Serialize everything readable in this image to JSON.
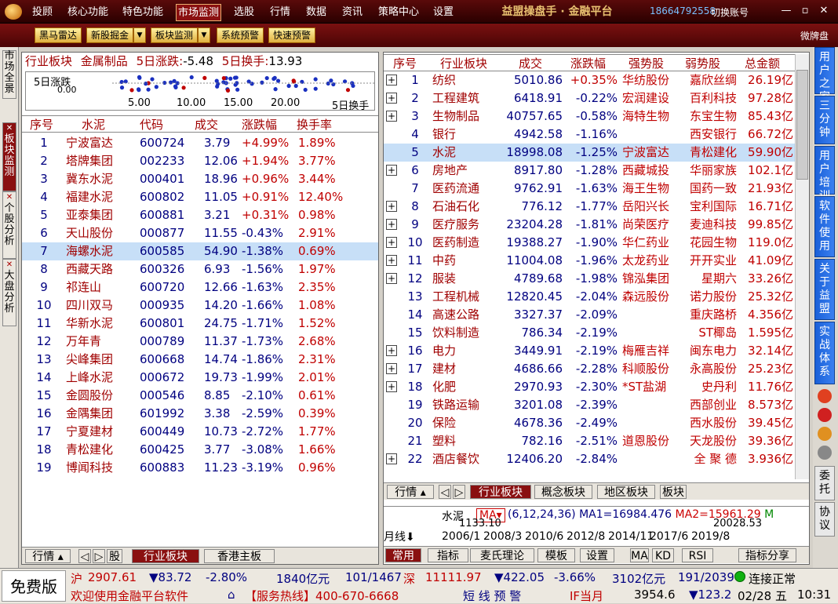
{
  "menu": [
    "投顾",
    "核心功能",
    "特色功能",
    "市场监测",
    "选股",
    "行情",
    "数据",
    "资讯",
    "策略中心",
    "设置"
  ],
  "active_menu": "市场监测",
  "brand": "益盟操盘手 · 金融平台",
  "phone": "18664792558",
  "switch_account": "切换账号",
  "toolbar": {
    "buttons": [
      "黑马雷达",
      "新股掘金",
      "板块监测",
      "系统预警",
      "快速预警"
    ],
    "right": "微牌盘"
  },
  "left_tabs": [
    {
      "label": "市场全景",
      "active": false
    },
    {
      "label": "板块监测",
      "active": true
    },
    {
      "label": "个股分析",
      "active": false
    },
    {
      "label": "大盘分析",
      "active": false
    }
  ],
  "right_tabs": [
    "用户之家",
    "三分钟",
    "用户培训",
    "软件使用",
    "关于益盟",
    "实战体系"
  ],
  "right_tabs_bottom": [
    "委托",
    "协议"
  ],
  "left_panel": {
    "header": {
      "label": "行业板块",
      "sector": "金属制品",
      "chg_label": "5日涨跌:",
      "chg": "-5.48",
      "turn_label": "5日换手:",
      "turn": "13.93"
    },
    "mini_chart": {
      "ylabel": "5日涨跌",
      "ylabel2": "0.00",
      "xticks": [
        "5.00",
        "10.00",
        "15.00",
        "20.00"
      ],
      "xlabel": "5日换手"
    },
    "columns": [
      "序号",
      "水泥",
      "代码",
      "成交",
      "涨跌幅",
      "换手率"
    ],
    "rows": [
      [
        "1",
        "宁波富达",
        "600724",
        "3.79",
        "+4.99%",
        "1.89%"
      ],
      [
        "2",
        "塔牌集团",
        "002233",
        "12.06",
        "+1.94%",
        "3.77%"
      ],
      [
        "3",
        "冀东水泥",
        "000401",
        "18.96",
        "+0.96%",
        "3.44%"
      ],
      [
        "4",
        "福建水泥",
        "600802",
        "11.05",
        "+0.91%",
        "12.40%"
      ],
      [
        "5",
        "亚泰集团",
        "600881",
        "3.21",
        "+0.31%",
        "0.98%"
      ],
      [
        "6",
        "天山股份",
        "000877",
        "11.55",
        "-0.43%",
        "2.91%"
      ],
      [
        "7",
        "海螺水泥",
        "600585",
        "54.90",
        "-1.38%",
        "0.69%"
      ],
      [
        "8",
        "西藏天路",
        "600326",
        "6.93",
        "-1.56%",
        "1.97%"
      ],
      [
        "9",
        "祁连山",
        "600720",
        "12.66",
        "-1.63%",
        "2.35%"
      ],
      [
        "10",
        "四川双马",
        "000935",
        "14.20",
        "-1.66%",
        "1.08%"
      ],
      [
        "11",
        "华新水泥",
        "600801",
        "24.75",
        "-1.71%",
        "1.52%"
      ],
      [
        "12",
        "万年青",
        "000789",
        "11.37",
        "-1.73%",
        "2.68%"
      ],
      [
        "13",
        "尖峰集团",
        "600668",
        "14.74",
        "-1.86%",
        "2.31%"
      ],
      [
        "14",
        "上峰水泥",
        "000672",
        "19.73",
        "-1.99%",
        "2.01%"
      ],
      [
        "15",
        "金圆股份",
        "000546",
        "8.85",
        "-2.10%",
        "0.61%"
      ],
      [
        "16",
        "金隅集团",
        "601992",
        "3.38",
        "-2.59%",
        "0.39%"
      ],
      [
        "17",
        "宁夏建材",
        "600449",
        "10.73",
        "-2.72%",
        "1.77%"
      ],
      [
        "18",
        "青松建化",
        "600425",
        "3.77",
        "-3.08%",
        "1.66%"
      ],
      [
        "19",
        "博闻科技",
        "600883",
        "11.23",
        "-3.19%",
        "0.96%"
      ]
    ],
    "selected_row": 6,
    "bottom_tabs": [
      "行情",
      "股",
      "行业板块",
      "香港主板"
    ]
  },
  "right_panel": {
    "columns": [
      "序号",
      "行业板块",
      "成交",
      "涨跌幅",
      "强势股",
      "弱势股",
      "总金额"
    ],
    "rows": [
      {
        "plus": true,
        "no": "1",
        "name": "纺织",
        "vol": "5010.86",
        "chg": "+0.35%",
        "strong": "华纺股份",
        "weak": "嘉欣丝绸",
        "amt": "26.19亿"
      },
      {
        "plus": true,
        "no": "2",
        "name": "工程建筑",
        "vol": "6418.91",
        "chg": "-0.22%",
        "strong": "宏润建设",
        "weak": "百利科技",
        "amt": "97.28亿"
      },
      {
        "plus": true,
        "no": "3",
        "name": "生物制品",
        "vol": "40757.65",
        "chg": "-0.58%",
        "strong": "海特生物",
        "weak": "东宝生物",
        "amt": "85.43亿"
      },
      {
        "plus": false,
        "no": "4",
        "name": "银行",
        "vol": "4942.58",
        "chg": "-1.16%",
        "strong": "",
        "weak": "西安银行",
        "amt": "66.72亿"
      },
      {
        "plus": false,
        "no": "5",
        "name": "水泥",
        "vol": "18998.08",
        "chg": "-1.25%",
        "strong": "宁波富达",
        "weak": "青松建化",
        "amt": "59.90亿"
      },
      {
        "plus": true,
        "no": "6",
        "name": "房地产",
        "vol": "8917.80",
        "chg": "-1.28%",
        "strong": "西藏城投",
        "weak": "华丽家族",
        "amt": "102.1亿"
      },
      {
        "plus": false,
        "no": "7",
        "name": "医药流通",
        "vol": "9762.91",
        "chg": "-1.63%",
        "strong": "海王生物",
        "weak": "国药一致",
        "amt": "21.93亿"
      },
      {
        "plus": true,
        "no": "8",
        "name": "石油石化",
        "vol": "776.12",
        "chg": "-1.77%",
        "strong": "岳阳兴长",
        "weak": "宝利国际",
        "amt": "16.71亿"
      },
      {
        "plus": true,
        "no": "9",
        "name": "医疗服务",
        "vol": "23204.28",
        "chg": "-1.81%",
        "strong": "尚荣医疗",
        "weak": "麦迪科技",
        "amt": "99.85亿"
      },
      {
        "plus": true,
        "no": "10",
        "name": "医药制造",
        "vol": "19388.27",
        "chg": "-1.90%",
        "strong": "华仁药业",
        "weak": "花园生物",
        "amt": "119.0亿"
      },
      {
        "plus": true,
        "no": "11",
        "name": "中药",
        "vol": "11004.08",
        "chg": "-1.96%",
        "strong": "太龙药业",
        "weak": "开开实业",
        "amt": "41.09亿"
      },
      {
        "plus": true,
        "no": "12",
        "name": "服装",
        "vol": "4789.68",
        "chg": "-1.98%",
        "strong": "锦泓集团",
        "weak": "星期六",
        "amt": "33.26亿"
      },
      {
        "plus": false,
        "no": "13",
        "name": "工程机械",
        "vol": "12820.45",
        "chg": "-2.04%",
        "strong": "森远股份",
        "weak": "诺力股份",
        "amt": "25.32亿"
      },
      {
        "plus": false,
        "no": "14",
        "name": "高速公路",
        "vol": "3327.37",
        "chg": "-2.09%",
        "strong": "",
        "weak": "重庆路桥",
        "amt": "4.356亿"
      },
      {
        "plus": false,
        "no": "15",
        "name": "饮料制造",
        "vol": "786.34",
        "chg": "-2.19%",
        "strong": "",
        "weak": "ST椰岛",
        "amt": "1.595亿"
      },
      {
        "plus": true,
        "no": "16",
        "name": "电力",
        "vol": "3449.91",
        "chg": "-2.19%",
        "strong": "梅雁吉祥",
        "weak": "闽东电力",
        "amt": "32.14亿"
      },
      {
        "plus": true,
        "no": "17",
        "name": "建材",
        "vol": "4686.66",
        "chg": "-2.28%",
        "strong": "科顺股份",
        "weak": "永高股份",
        "amt": "25.23亿"
      },
      {
        "plus": true,
        "no": "18",
        "name": "化肥",
        "vol": "2970.93",
        "chg": "-2.30%",
        "strong": "*ST盐湖",
        "weak": "史丹利",
        "amt": "11.76亿"
      },
      {
        "plus": false,
        "no": "19",
        "name": "铁路运输",
        "vol": "3201.08",
        "chg": "-2.39%",
        "strong": "",
        "weak": "西部创业",
        "amt": "8.573亿"
      },
      {
        "plus": false,
        "no": "20",
        "name": "保险",
        "vol": "4678.36",
        "chg": "-2.49%",
        "strong": "",
        "weak": "西水股份",
        "amt": "39.45亿"
      },
      {
        "plus": false,
        "no": "21",
        "name": "塑料",
        "vol": "782.16",
        "chg": "-2.51%",
        "strong": "道恩股份",
        "weak": "天龙股份",
        "amt": "39.36亿"
      },
      {
        "plus": true,
        "no": "22",
        "name": "酒店餐饮",
        "vol": "12406.20",
        "chg": "-2.84%",
        "strong": "",
        "weak": "全 聚 德",
        "amt": "3.936亿"
      }
    ],
    "selected_row": 4,
    "bottom_tabs": [
      "行情",
      "行业板块",
      "概念板块",
      "地区板块",
      "板块"
    ],
    "kline": {
      "name": "水泥",
      "ma_btn": "MA",
      "ma_params": "(6,12,24,36)",
      "ma1": "MA1=16984.476",
      "ma2": "MA2=15961.29",
      "ma_more": "M",
      "val1": "1133.10",
      "val2": "20028.53",
      "period": "月线",
      "dates": [
        "2006/1",
        "2008/3",
        "2010/6",
        "2012/8",
        "2014/11",
        "2017/6",
        "2019/8"
      ]
    },
    "kbar": [
      "常用",
      "指标",
      "麦氏理论",
      "模板",
      "设置",
      "MA",
      "KD",
      "RSI",
      "指标分享"
    ]
  },
  "status": {
    "free": "免费版",
    "sh_label": "沪",
    "sh": "2907.61",
    "sh_chg": "▼83.72",
    "sh_pct": "-2.80%",
    "sh_amt": "1840亿元",
    "sh_cnt": "101/1467",
    "sz_label": "深",
    "sz": "11111.97",
    "sz_chg": "▼422.05",
    "sz_pct": "-3.66%",
    "sz_amt": "3102亿元",
    "sz_cnt": "191/2039",
    "conn": "连接正常",
    "welcome": "欢迎使用金融平台软件",
    "hotline": "【服务热线】400-670-6668",
    "warn": "短 线 预 警",
    "if_label": "IF当月",
    "if_val": "3954.6",
    "if_chg": "▼123.2",
    "date": "02/28 五",
    "time": "10:31"
  }
}
